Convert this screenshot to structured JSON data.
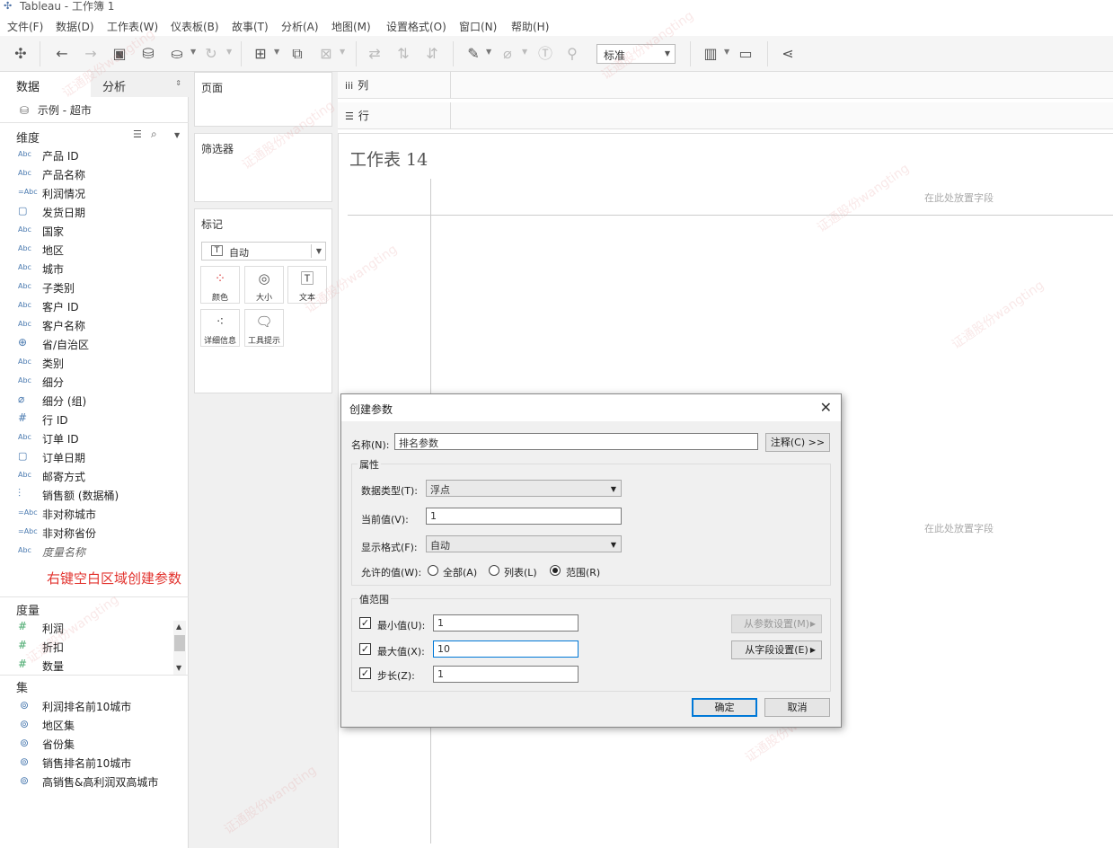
{
  "window": {
    "title": "Tableau - 工作簿 1"
  },
  "menu": [
    "文件(F)",
    "数据(D)",
    "工作表(W)",
    "仪表板(B)",
    "故事(T)",
    "分析(A)",
    "地图(M)",
    "设置格式(O)",
    "窗口(N)",
    "帮助(H)"
  ],
  "toolbar": {
    "fit_value": "标准"
  },
  "data_pane": {
    "tab_data": "数据",
    "tab_analysis": "分析",
    "datasource": "示例 - 超市",
    "dimensions_header": "维度",
    "dimensions": [
      {
        "type": "Abc",
        "label": "产品 ID"
      },
      {
        "type": "Abc",
        "label": "产品名称"
      },
      {
        "type": "=Abc",
        "label": "利润情况"
      },
      {
        "type": "date",
        "label": "发货日期"
      },
      {
        "type": "Abc",
        "label": "国家"
      },
      {
        "type": "Abc",
        "label": "地区"
      },
      {
        "type": "Abc",
        "label": "城市"
      },
      {
        "type": "Abc",
        "label": "子类别"
      },
      {
        "type": "Abc",
        "label": "客户 ID"
      },
      {
        "type": "Abc",
        "label": "客户名称"
      },
      {
        "type": "geo",
        "label": "省/自治区"
      },
      {
        "type": "Abc",
        "label": "类别"
      },
      {
        "type": "Abc",
        "label": "细分"
      },
      {
        "type": "clip",
        "label": "细分 (组)"
      },
      {
        "type": "#",
        "label": "行 ID"
      },
      {
        "type": "Abc",
        "label": "订单 ID"
      },
      {
        "type": "date",
        "label": "订单日期"
      },
      {
        "type": "Abc",
        "label": "邮寄方式"
      },
      {
        "type": "bin",
        "label": "销售额 (数据桶)"
      },
      {
        "type": "=Abc",
        "label": "非对称城市"
      },
      {
        "type": "=Abc",
        "label": "非对称省份"
      },
      {
        "type": "Abc",
        "label": "度量名称"
      }
    ],
    "annotation": "右键空白区域创建参数",
    "measures_header": "度量",
    "measures": [
      "利润",
      "折扣",
      "数量"
    ],
    "sets_header": "集",
    "sets": [
      "利润排名前10城市",
      "地区集",
      "省份集",
      "销售排名前10城市",
      "高销售&高利润双高城市"
    ]
  },
  "shelves": {
    "pages": "页面",
    "filters": "筛选器",
    "marks": "标记",
    "mark_type": "自动",
    "mark_buttons": [
      "颜色",
      "大小",
      "文本",
      "详细信息",
      "工具提示"
    ],
    "columns": "列",
    "rows": "行"
  },
  "view": {
    "sheet_title": "工作表 14",
    "drop_hint_top": "在此处放置字段",
    "drop_hint_mid": "在此处放置字段"
  },
  "dialog": {
    "title": "创建参数",
    "name_label": "名称(N):",
    "name_value": "排名参数",
    "comment_button": "注释(C) >>",
    "properties_group": "属性",
    "data_type_label": "数据类型(T):",
    "data_type_value": "浮点",
    "current_value_label": "当前值(V):",
    "current_value": "1",
    "display_format_label": "显示格式(F):",
    "display_format_value": "自动",
    "allowed_label": "允许的值(W):",
    "allowed_options": [
      "全部(A)",
      "列表(L)",
      "范围(R)"
    ],
    "allowed_selected": "范围(R)",
    "range_group": "值范围",
    "min_label": "最小值(U):",
    "min_value": "1",
    "max_label": "最大值(X):",
    "max_value": "10",
    "step_label": "步长(Z):",
    "step_value": "1",
    "from_param_button": "从参数设置(M)",
    "from_field_button": "从字段设置(E)",
    "ok_button": "确定",
    "cancel_button": "取消"
  },
  "watermark": "证通股份wangting"
}
